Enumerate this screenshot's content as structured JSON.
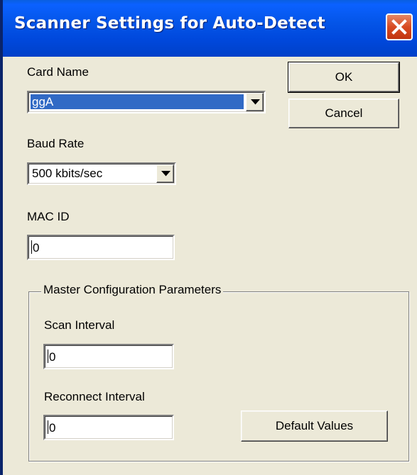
{
  "window": {
    "title": "Scanner Settings for Auto-Detect"
  },
  "card_name": {
    "label": "Card Name",
    "value": "ggA"
  },
  "baud_rate": {
    "label": "Baud Rate",
    "value": "500 kbits/sec"
  },
  "mac_id": {
    "label": "MAC ID",
    "value": "0"
  },
  "master_config": {
    "legend": "Master Configuration Parameters",
    "scan_interval": {
      "label": "Scan Interval",
      "value": "0"
    },
    "reconnect_interval": {
      "label": "Reconnect Interval",
      "value": "0"
    },
    "default_values_label": "Default Values"
  },
  "buttons": {
    "ok_label": "OK",
    "cancel_label": "Cancel"
  },
  "icons": {
    "close": "close-icon",
    "dropdown": "chevron-down-icon"
  },
  "colors": {
    "titlebar": "#0455e8",
    "close_button": "#d84a21",
    "dialog_background": "#ece9d8",
    "selection_highlight": "#316ac5"
  }
}
